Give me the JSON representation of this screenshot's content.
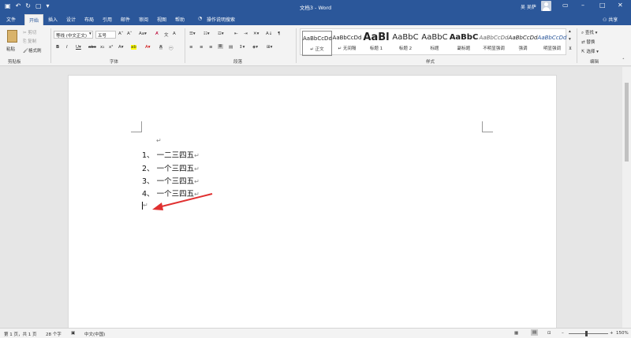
{
  "titlebar": {
    "doc_title": "文档3 - Word",
    "user_name": "吴 吴萨",
    "quick_access": [
      "save-icon",
      "undo-icon",
      "redo-icon",
      "open-icon",
      "customize-icon"
    ],
    "colors": {
      "brand": "#2b579a"
    }
  },
  "tabs": [
    "文件",
    "开始",
    "插入",
    "设计",
    "布局",
    "引用",
    "邮件",
    "审阅",
    "视图",
    "帮助"
  ],
  "active_tab": "开始",
  "tell_me": "操作说明搜索",
  "share": "共享",
  "ribbon": {
    "clipboard": {
      "paste": "粘贴",
      "cut": "剪切",
      "copy": "复制",
      "format_painter": "格式刷",
      "label": "剪贴板"
    },
    "font": {
      "font_name": "等线 (中文正文)",
      "font_size": "五号",
      "label": "字体"
    },
    "paragraph": {
      "label": "段落"
    },
    "styles": {
      "label": "样式",
      "items": [
        {
          "sample": "AaBbCcDd",
          "name": "↵ 正文"
        },
        {
          "sample": "AaBbCcDd",
          "name": "↵ 无间隔"
        },
        {
          "sample": "AaBl",
          "name": "标题 1"
        },
        {
          "sample": "AaBbC",
          "name": "标题 2"
        },
        {
          "sample": "AaBbC",
          "name": "标题"
        },
        {
          "sample": "AaBbC",
          "name": "副标题"
        },
        {
          "sample": "AaBbCcDd",
          "name": "不明显强调"
        },
        {
          "sample": "AaBbCcDd",
          "name": "强调"
        },
        {
          "sample": "AaBbCcDd",
          "name": "明显强调"
        }
      ]
    },
    "editing": {
      "find": "查找",
      "replace": "替换",
      "select": "选择",
      "label": "编辑"
    }
  },
  "document": {
    "empty_mark": "↵",
    "lines": [
      {
        "num": "1、",
        "text": "一二三四五"
      },
      {
        "num": "2、",
        "text": "一个三四五"
      },
      {
        "num": "3、",
        "text": "一个三四五"
      },
      {
        "num": "4、",
        "text": "一个三四五"
      }
    ],
    "para_mark": "↵",
    "cursor_line_mark": "↵",
    "arrow_color": "#e03030"
  },
  "status": {
    "page": "第 1 页，共 1 页",
    "words": "28 个字",
    "language": "中文(中国)",
    "zoom": "150%"
  }
}
